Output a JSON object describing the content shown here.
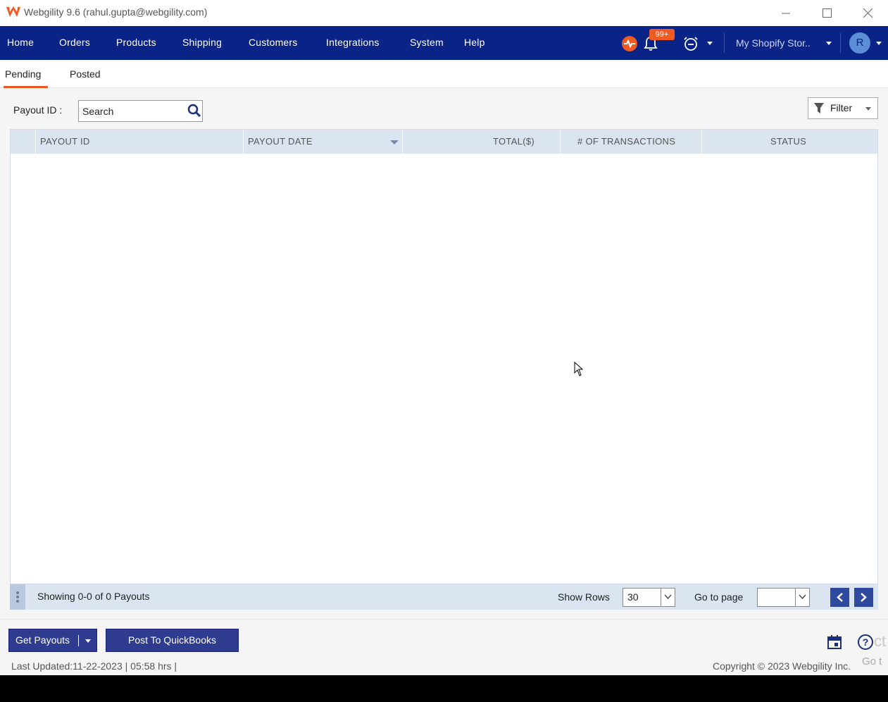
{
  "window": {
    "title": "Webgility 9.6 (rahul.gupta@webgility.com)"
  },
  "nav": {
    "items": [
      "Home",
      "Orders",
      "Products",
      "Shipping",
      "Customers",
      "Integrations",
      "System",
      "Help"
    ],
    "notification_count": "99+",
    "store": "My Shopify Stor..",
    "avatar_initial": "R"
  },
  "tabs": {
    "pending": "Pending",
    "posted": "Posted"
  },
  "search": {
    "label": "Payout ID :",
    "placeholder": "Search"
  },
  "filter": {
    "label": "Filter"
  },
  "grid": {
    "columns": [
      "PAYOUT ID",
      "PAYOUT DATE",
      "TOTAL($)",
      "# OF TRANSACTIONS",
      "STATUS"
    ],
    "rows": []
  },
  "pager": {
    "showing": "Showing 0-0 of 0 Payouts",
    "show_rows_label": "Show Rows",
    "rows_value": "30",
    "goto_label": "Go to page"
  },
  "footer": {
    "get_payouts": "Get Payouts",
    "post_quickbooks": "Post To QuickBooks",
    "last_updated": "Last Updated:11-22-2023 | 05:58 hrs |",
    "copyright": "Copyright © 2023 Webgility Inc.",
    "watermark_top": "ct",
    "watermark_bottom": "Go t"
  },
  "colors": {
    "nav_bg": "#0a2387",
    "accent": "#f05a22",
    "grid_header": "#dbe5f1",
    "button_bg": "#2e3b8f"
  }
}
